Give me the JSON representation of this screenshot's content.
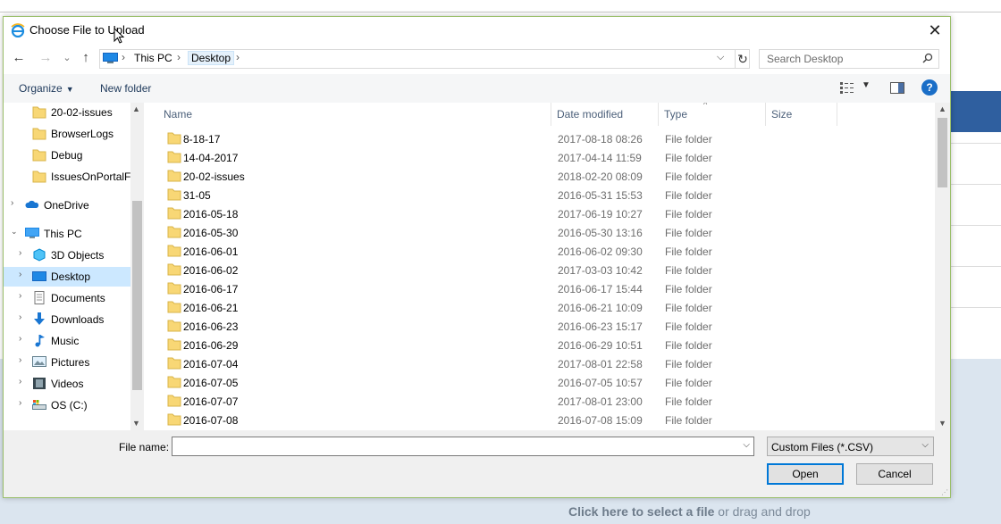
{
  "dialog": {
    "title": "Choose File to Upload",
    "close_label": "✕"
  },
  "nav": {
    "back": "←",
    "forward": "→",
    "recent": "⌄",
    "up": "↑",
    "breadcrumb": [
      "This PC",
      "Desktop"
    ],
    "search_placeholder": "Search Desktop"
  },
  "toolbar": {
    "organize_label": "Organize",
    "new_folder_label": "New folder",
    "help_label": "?"
  },
  "navpane": {
    "items": [
      {
        "label": "20-02-issues",
        "icon": "folder-icon"
      },
      {
        "label": "BrowserLogs",
        "icon": "folder-icon"
      },
      {
        "label": "Debug",
        "icon": "folder-icon"
      },
      {
        "label": "IssuesOnPortalFi",
        "icon": "folder-icon"
      },
      {
        "label": "OneDrive",
        "icon": "cloud-icon"
      },
      {
        "label": "This PC",
        "icon": "computer-icon"
      },
      {
        "label": "3D Objects",
        "icon": "cube-icon"
      },
      {
        "label": "Desktop",
        "icon": "desktop-icon"
      },
      {
        "label": "Documents",
        "icon": "document-icon"
      },
      {
        "label": "Downloads",
        "icon": "download-icon"
      },
      {
        "label": "Music",
        "icon": "music-icon"
      },
      {
        "label": "Pictures",
        "icon": "pictures-icon"
      },
      {
        "label": "Videos",
        "icon": "video-icon"
      },
      {
        "label": "OS (C:)",
        "icon": "drive-icon"
      }
    ]
  },
  "filelist": {
    "columns": [
      "Name",
      "Date modified",
      "Type",
      "Size"
    ],
    "rows": [
      {
        "name": "8-18-17",
        "date": "2017-08-18 08:26",
        "type": "File folder"
      },
      {
        "name": "14-04-2017",
        "date": "2017-04-14 11:59",
        "type": "File folder"
      },
      {
        "name": "20-02-issues",
        "date": "2018-02-20 08:09",
        "type": "File folder"
      },
      {
        "name": "31-05",
        "date": "2016-05-31 15:53",
        "type": "File folder"
      },
      {
        "name": "2016-05-18",
        "date": "2017-06-19 10:27",
        "type": "File folder"
      },
      {
        "name": "2016-05-30",
        "date": "2016-05-30 13:16",
        "type": "File folder"
      },
      {
        "name": "2016-06-01",
        "date": "2016-06-02 09:30",
        "type": "File folder"
      },
      {
        "name": "2016-06-02",
        "date": "2017-03-03 10:42",
        "type": "File folder"
      },
      {
        "name": "2016-06-17",
        "date": "2016-06-17 15:44",
        "type": "File folder"
      },
      {
        "name": "2016-06-21",
        "date": "2016-06-21 10:09",
        "type": "File folder"
      },
      {
        "name": "2016-06-23",
        "date": "2016-06-23 15:17",
        "type": "File folder"
      },
      {
        "name": "2016-06-29",
        "date": "2016-06-29 10:51",
        "type": "File folder"
      },
      {
        "name": "2016-07-04",
        "date": "2017-08-01 22:58",
        "type": "File folder"
      },
      {
        "name": "2016-07-05",
        "date": "2016-07-05 10:57",
        "type": "File folder"
      },
      {
        "name": "2016-07-07",
        "date": "2017-08-01 23:00",
        "type": "File folder"
      },
      {
        "name": "2016-07-08",
        "date": "2016-07-08 15:09",
        "type": "File folder"
      }
    ]
  },
  "bottom": {
    "file_name_label": "File name:",
    "file_name_value": "",
    "filter_value": "Custom Files (*.CSV)",
    "open_label": "Open",
    "cancel_label": "Cancel"
  },
  "background": {
    "drop_strong": "Click here to select a file",
    "drop_rest": " or drag and drop"
  },
  "colors": {
    "accent": "#0078d7",
    "folder": "#f8d775",
    "selection": "#cce8ff"
  }
}
